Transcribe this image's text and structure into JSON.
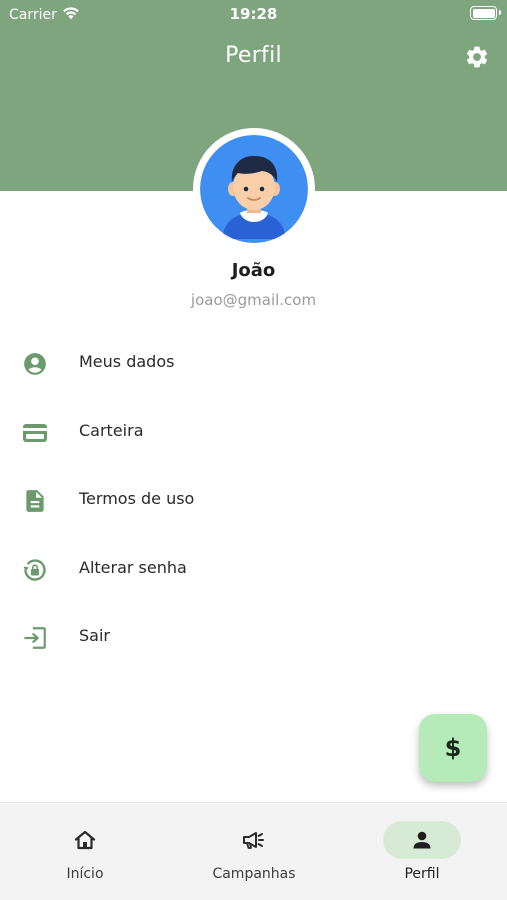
{
  "status_bar": {
    "carrier": "Carrier",
    "time": "19:28"
  },
  "header": {
    "title": "Perfil",
    "settings_icon": "gear-icon"
  },
  "profile": {
    "name": "João",
    "email": "joao@gmail.com",
    "avatar_icon": "boy-avatar"
  },
  "menu": {
    "items": [
      {
        "label": "Meus dados",
        "icon": "account-circle-icon"
      },
      {
        "label": "Carteira",
        "icon": "wallet-icon"
      },
      {
        "label": "Termos de uso",
        "icon": "document-icon"
      },
      {
        "label": "Alterar senha",
        "icon": "lock-reset-icon"
      },
      {
        "label": "Sair",
        "icon": "logout-icon"
      }
    ]
  },
  "fab": {
    "label": "$"
  },
  "bottom_nav": {
    "items": [
      {
        "label": "Início",
        "icon": "home-icon",
        "active": false
      },
      {
        "label": "Campanhas",
        "icon": "megaphone-icon",
        "active": false
      },
      {
        "label": "Perfil",
        "icon": "person-icon",
        "active": true
      }
    ]
  },
  "colors": {
    "header": "#7fa57e",
    "icon_green": "#6d9a6d",
    "fab": "#b6eab8",
    "nav_active_pill": "#d7ead5",
    "nav_background": "#f3f3f3"
  }
}
